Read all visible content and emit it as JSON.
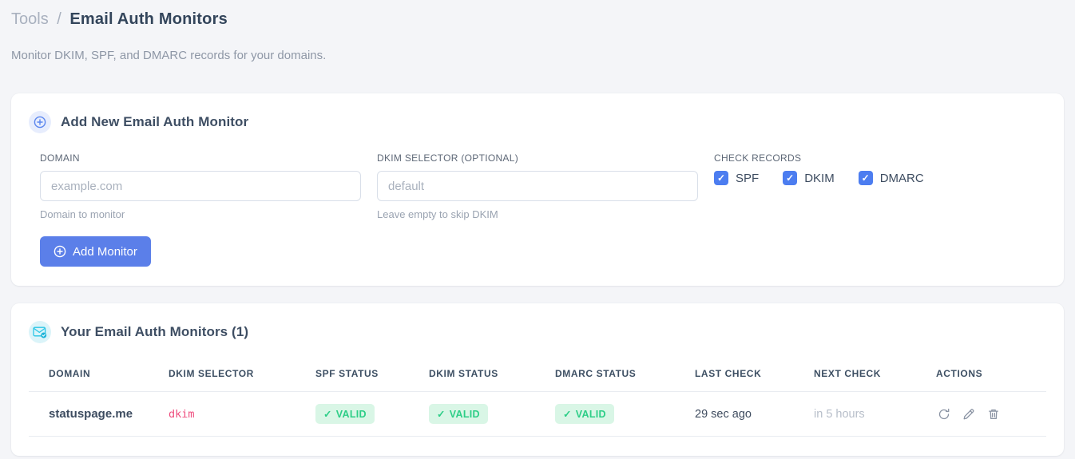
{
  "breadcrumb": {
    "section": "Tools",
    "separator": "/",
    "title": "Email Auth Monitors"
  },
  "subtitle": "Monitor DKIM, SPF, and DMARC records for your domains.",
  "add_card": {
    "title": "Add New Email Auth Monitor",
    "domain_field": {
      "label": "DOMAIN",
      "placeholder": "example.com",
      "value": "",
      "hint": "Domain to monitor"
    },
    "dkim_field": {
      "label": "DKIM SELECTOR (OPTIONAL)",
      "placeholder": "default",
      "value": "",
      "hint": "Leave empty to skip DKIM"
    },
    "check_records": {
      "label": "CHECK RECORDS",
      "options": [
        {
          "label": "SPF",
          "checked": true
        },
        {
          "label": "DKIM",
          "checked": true
        },
        {
          "label": "DMARC",
          "checked": true
        }
      ]
    },
    "submit_label": "Add Monitor"
  },
  "monitors_card": {
    "title": "Your Email Auth Monitors (1)",
    "table": {
      "headers": [
        "DOMAIN",
        "DKIM SELECTOR",
        "SPF STATUS",
        "DKIM STATUS",
        "DMARC STATUS",
        "LAST CHECK",
        "NEXT CHECK",
        "ACTIONS"
      ],
      "rows": [
        {
          "domain": "statuspage.me",
          "dkim_selector": "dkim",
          "spf_status": "VALID",
          "dkim_status": "VALID",
          "dmarc_status": "VALID",
          "last_check": "29 sec ago",
          "next_check": "in 5 hours"
        }
      ]
    }
  },
  "glyphs": {
    "check": "✓"
  },
  "icons": {
    "add_card_header": "plus-circle-icon",
    "monitors_card_header": "envelope-check-icon",
    "button": "plus-circle-icon",
    "row_actions": [
      "refresh-icon",
      "edit-icon",
      "delete-icon"
    ]
  },
  "colors": {
    "page_bg": "#f4f5f8",
    "accent_checkbox_blue": "#4c7df0",
    "button_blue": "#5b7fe9",
    "icon_blue": "#5b86ee",
    "icon_cyan": "#29c5e6",
    "badge_green_bg": "#d9f6e6",
    "badge_green_text": "#2dce87",
    "code_pink": "#ee4d7e",
    "heading_dark": "#33455b",
    "muted_gray": "#8e97a6"
  }
}
